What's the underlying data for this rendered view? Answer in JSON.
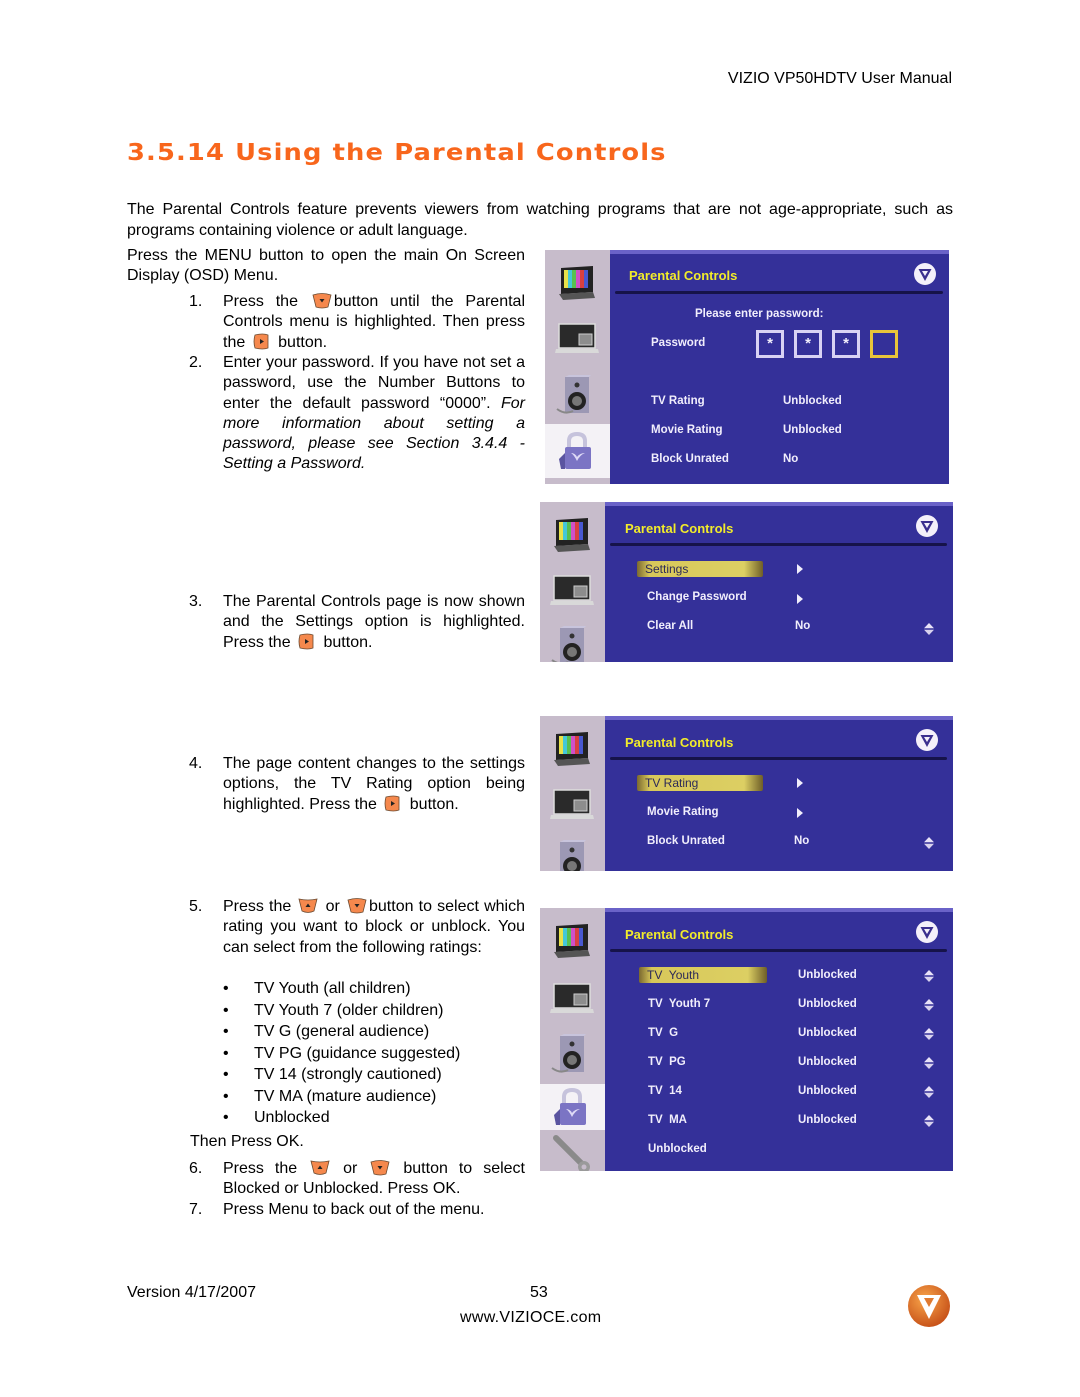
{
  "header": {
    "manual_title": "VIZIO VP50HDTV User Manual"
  },
  "section": {
    "title": "3.5.14 Using the Parental Controls"
  },
  "intro": "The Parental Controls feature prevents viewers from watching programs that are not age-appropriate, such as programs containing violence or adult language.",
  "menu_intro": "Press the MENU button to open the main On Screen Display (OSD) Menu.",
  "steps": [
    {
      "num": "1.",
      "pre": "Press the",
      "icon1": "down-button-icon",
      "post": "button until the Parental Controls menu is highlighted. Then press the",
      "icon2": "right-button-icon",
      "end": "button."
    },
    {
      "num": "2.",
      "text": "Enter your password. If you have not set a password, use the Number Buttons to enter the default password “0000”.",
      "italic": "For more information about setting a password, please see Section 3.4.4 - Setting a Password."
    },
    {
      "num": "3.",
      "pre": "The Parental Controls page is now shown and the Settings option is highlighted.  Press the",
      "icon1": "right-button-icon",
      "end": "button."
    },
    {
      "num": "4.",
      "pre": "The page content changes to the settings options, the TV Rating option being highlighted. Press the",
      "icon1": "right-button-icon",
      "end": "button."
    },
    {
      "num": "5.",
      "pre": "Press the",
      "icon1": "up-button-icon",
      "mid": "or",
      "icon2": "down-button-icon",
      "post": "button to select which rating you want to block or unblock. You can select from the following ratings:"
    },
    {
      "num": "6.",
      "pre": "Press the",
      "icon1": "up-button-icon",
      "mid": "or",
      "icon2": "down-button-icon",
      "post": "button to select Blocked or Unblocked. Press OK."
    },
    {
      "num": "7.",
      "text": "Press Menu to back out of the menu."
    }
  ],
  "ratings_list": [
    "TV Youth (all children)",
    "TV Youth 7 (older children)",
    "TV G (general audience)",
    "TV PG (guidance suggested)",
    "TV 14 (strongly cautioned)",
    "TV MA (mature audience)",
    "Unblocked"
  ],
  "then_press": "Then Press OK.",
  "osd_screens": [
    {
      "title": "Parental Controls",
      "prompt": "Please enter password:",
      "password_label": "Password",
      "password_boxes": [
        "*",
        "*",
        "*",
        ""
      ],
      "rows": [
        {
          "label": "TV Rating",
          "value": "Unblocked"
        },
        {
          "label": "Movie Rating",
          "value": "Unblocked"
        },
        {
          "label": "Block Unrated",
          "value": "No"
        }
      ]
    },
    {
      "title": "Parental Controls",
      "rows": [
        {
          "label": "Settings",
          "value": "",
          "highlighted": true,
          "control": "arrow"
        },
        {
          "label": "Change Password",
          "value": "",
          "control": "arrow"
        },
        {
          "label": "Clear All",
          "value": "No",
          "control": "updown"
        }
      ]
    },
    {
      "title": "Parental Controls",
      "rows": [
        {
          "label": "TV Rating",
          "value": "",
          "highlighted": true,
          "control": "arrow"
        },
        {
          "label": "Movie Rating",
          "value": "",
          "control": "arrow"
        },
        {
          "label": "Block Unrated",
          "value": "No",
          "control": "updown"
        }
      ]
    },
    {
      "title": "Parental Controls",
      "rows": [
        {
          "label": "TV  Youth",
          "value": "Unblocked",
          "highlighted": true,
          "control": "updown"
        },
        {
          "label": "TV  Youth 7",
          "value": "Unblocked",
          "control": "updown"
        },
        {
          "label": "TV  G",
          "value": "Unblocked",
          "control": "updown"
        },
        {
          "label": "TV  PG",
          "value": "Unblocked",
          "control": "updown"
        },
        {
          "label": "TV  14",
          "value": "Unblocked",
          "control": "updown"
        },
        {
          "label": "TV  MA",
          "value": "Unblocked",
          "control": "updown"
        },
        {
          "label": "Unblocked",
          "value": ""
        }
      ]
    }
  ],
  "osd_sidebar_icons": [
    "picture-icon",
    "pip-icon",
    "audio-speaker-icon",
    "parental-lock-icon",
    "setup-wrench-icon"
  ],
  "colors": {
    "title_orange": "#f8661c",
    "osd_blue": "#343099",
    "osd_title_yellow": "#f2ec2a",
    "osd_highlight": "#dccf63",
    "remote_button_orange": "#f5884d"
  },
  "footer": {
    "version": "Version 4/17/2007",
    "page_number": "53",
    "url": "www.VIZIOCE.com"
  }
}
